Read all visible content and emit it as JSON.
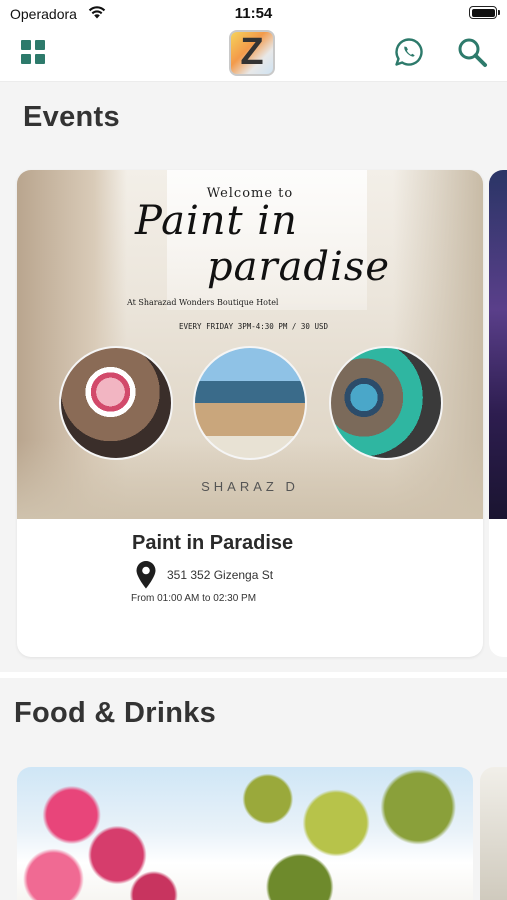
{
  "status_bar": {
    "carrier": "Operadora",
    "time": "11:54"
  },
  "nav": {
    "logo_letter": "Z",
    "icons": [
      "grid-icon",
      "whatsapp-icon",
      "search-icon"
    ],
    "accent_color": "#2d7a6b"
  },
  "events": {
    "title": "Events",
    "cards": [
      {
        "name": "Paint in Paradise",
        "address": "351 352 Gizenga St",
        "time": "From 01:00 AM to 02:30 PM",
        "flyer": {
          "welcome": "Welcome to",
          "script_line_1": "Paint in",
          "script_line_2": "paradise",
          "hotel": "At Sharazad Wonders Boutique Hotel",
          "schedule": "EVERY FRIDAY 3PM-4:30 PM / 30 USD",
          "brand": "SHARAZ D"
        }
      }
    ]
  },
  "food": {
    "title": "Food & Drinks"
  }
}
